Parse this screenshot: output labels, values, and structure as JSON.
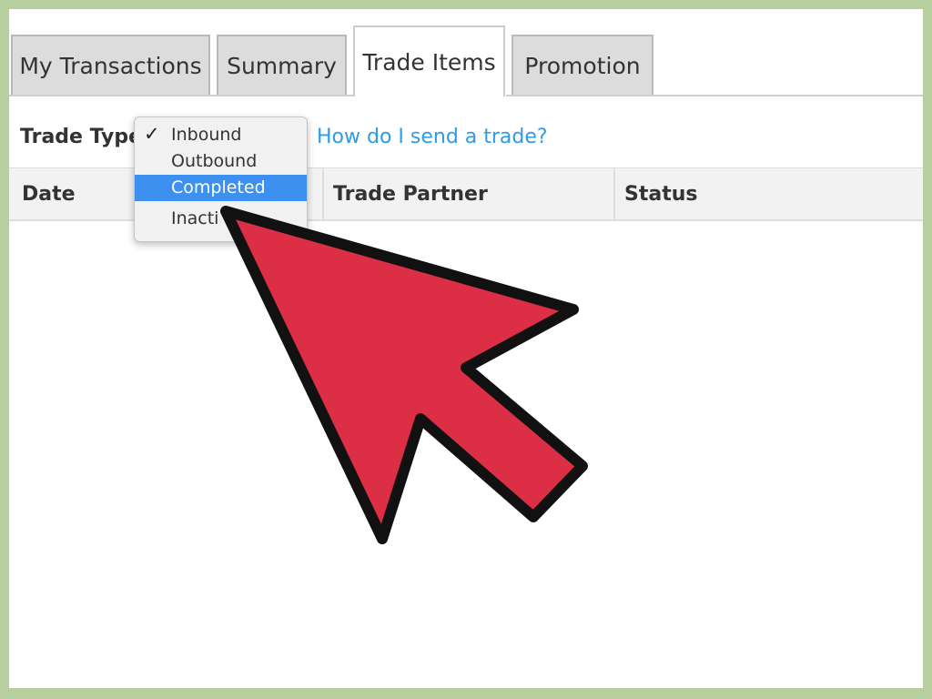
{
  "tabs": [
    {
      "label": "My Transactions"
    },
    {
      "label": "Summary"
    },
    {
      "label": "Trade Items"
    },
    {
      "label": "Promotion"
    }
  ],
  "trade_type": {
    "label": "Trade Type",
    "options": [
      {
        "label": "Inbound",
        "checked": true
      },
      {
        "label": "Outbound"
      },
      {
        "label": "Completed",
        "highlighted": true
      },
      {
        "label": "Inacti"
      }
    ]
  },
  "help_link": "How do I send a trade?",
  "table": {
    "columns": [
      "Date",
      "Trade Partner",
      "Status"
    ]
  },
  "colors": {
    "frame_border": "#b7cf9e",
    "link": "#2f9be6",
    "highlight": "#3d8ff0",
    "arrow_fill": "#dc2e45"
  },
  "icons": {
    "check": "checkmark-icon",
    "arrow": "pointer-arrow-icon"
  }
}
